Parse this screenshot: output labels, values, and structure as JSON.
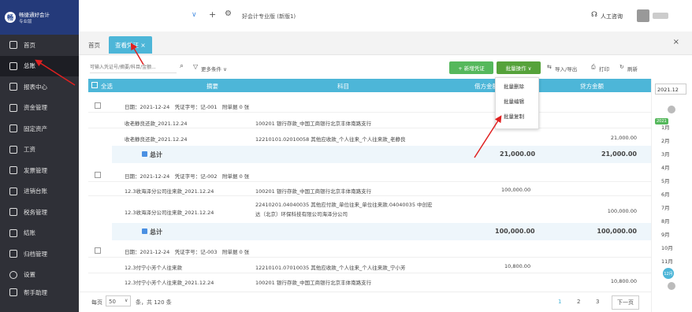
{
  "app": {
    "logo_text": "畅捷通好会计",
    "logo_sub": "专业版",
    "company": "好会计专业版 (新版1)",
    "help": "人工咨询"
  },
  "sidebar": {
    "items": [
      {
        "label": "首页"
      },
      {
        "label": "总账"
      },
      {
        "label": "报表中心"
      },
      {
        "label": "资金管理"
      },
      {
        "label": "固定资产"
      },
      {
        "label": "工资"
      },
      {
        "label": "发票管理"
      },
      {
        "label": "进销台账"
      },
      {
        "label": "税务管理"
      },
      {
        "label": "结账"
      },
      {
        "label": "归档管理"
      },
      {
        "label": "设置"
      },
      {
        "label": "帮手助理"
      }
    ]
  },
  "tabs": {
    "home": "首页",
    "voucher": "查看凭证 ×"
  },
  "toolbar": {
    "search_placeholder": "可输入凭证号/摘要/科目/金额...",
    "more": "更多条件 ∨",
    "add": "+ 新增凭证",
    "batch": "批量操作 ∨",
    "import": "导入/导出",
    "print": "打印",
    "refresh": "刷新",
    "batch_menu": [
      "批量删除",
      "批量编辑",
      "批量复制"
    ]
  },
  "grid": {
    "headers": [
      "全选",
      "摘要",
      "科目",
      "借方金额",
      "贷方金额"
    ]
  },
  "vouchers": [
    {
      "header": "日期：2021-12-24　凭证字号：记-001　附单据 0 张",
      "lines": [
        {
          "summary": "收老静良还款_2021.12.24",
          "subject": "100201 银行存款_中国工商银行北京丰体南路支行",
          "debit": "",
          "credit": ""
        },
        {
          "summary": "收老静良还款_2021.12.24",
          "subject": "12210101.02010058 其他应收款_个人往来_个人往来款_老静良",
          "debit": "",
          "credit": "21,000.00"
        }
      ],
      "total_label": "总计",
      "total_debit": "21,000.00",
      "total_credit": "21,000.00"
    },
    {
      "header": "日期：2021-12-24　凭证字号：记-002　附单据 0 张",
      "lines": [
        {
          "summary": "12.3收海泽分公司往来款_2021.12.24",
          "subject": "100201 银行存款_中国工商银行北京丰体南路支行",
          "debit": "100,000.00",
          "credit": ""
        },
        {
          "summary": "12.3收海泽分公司往来款_2021.12.24",
          "subject": "22410201.04040035 其他应付款_单位往来_单位往来款.04040035 中创宏达（北京）环保科技有限公司海泽分公司",
          "debit": "",
          "credit": "100,000.00"
        }
      ],
      "total_label": "总计",
      "total_debit": "100,000.00",
      "total_credit": "100,000.00"
    },
    {
      "header": "日期：2021-12-24　凭证字号：记-003　附单据 0 张",
      "lines": [
        {
          "summary": "12.3付宁小芳个人往来款",
          "subject": "12210101.07010035 其他应收款_个人往来_个人往来款_宁小芳",
          "debit": "10,800.00",
          "credit": ""
        },
        {
          "summary": "12.3付宁小芳个人往来款_2021.12.24",
          "subject": "100201 银行存款_中国工商银行北京丰体南路支行",
          "debit": "",
          "credit": "10,800.00"
        }
      ]
    }
  ],
  "footer": {
    "per_page": "每页",
    "size": "50",
    "summary": "条，共 120 条",
    "pages": [
      "1",
      "2",
      "3"
    ],
    "next": "下一页"
  },
  "calendar": {
    "period": "2021.12",
    "year": "2021",
    "months": [
      "1月",
      "2月",
      "3月",
      "4月",
      "5月",
      "6月",
      "7月",
      "8月",
      "9月",
      "10月",
      "11月",
      "12月"
    ]
  }
}
